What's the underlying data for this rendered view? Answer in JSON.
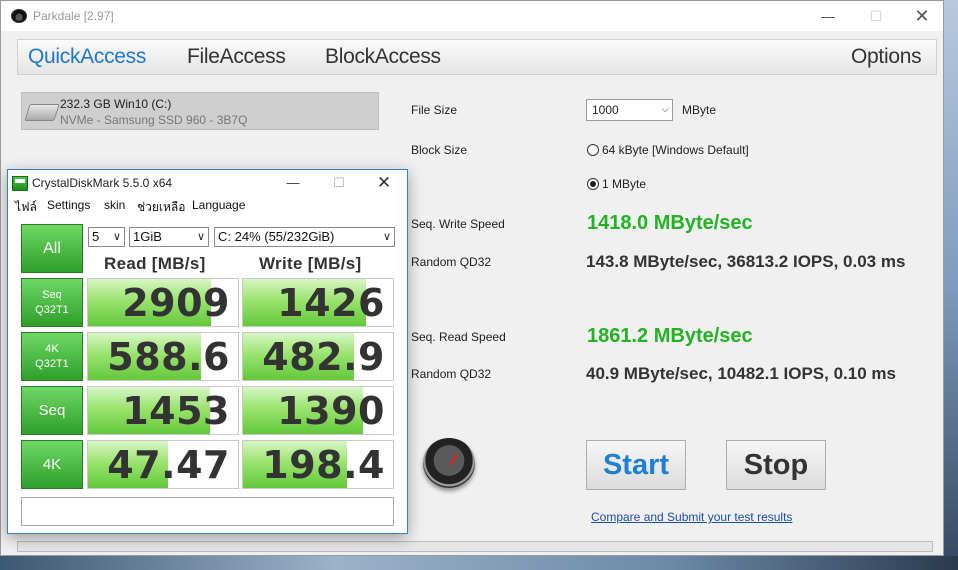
{
  "parkdale": {
    "title": "Parkdale [2.97]",
    "window_controls": {
      "minimize": "—",
      "maximize": "☐",
      "close": "✕"
    },
    "tabs": [
      "QuickAccess",
      "FileAccess",
      "BlockAccess",
      "Options"
    ],
    "active_tab": "QuickAccess",
    "drive": {
      "name": "232.3 GB Win10 (C:)",
      "model": "NVMe - Samsung SSD 960 - 3B7Q"
    },
    "file_size": {
      "label": "File Size",
      "value": "1000",
      "unit": "MByte"
    },
    "block_size": {
      "label": "Block Size",
      "options": [
        "64 kByte [Windows Default]",
        "1 MByte"
      ],
      "selected": "1 MByte"
    },
    "results": {
      "seq_write_label": "Seq. Write Speed",
      "seq_write_value": "1418.0 MByte/sec",
      "random_write_label": "Random QD32",
      "random_write_value": "143.8 MByte/sec, 36813.2 IOPS, 0.03 ms",
      "seq_read_label": "Seq. Read Speed",
      "seq_read_value": "1861.2 MByte/sec",
      "random_read_label": "Random QD32",
      "random_read_value": "40.9 MByte/sec, 10482.1 IOPS, 0.10 ms"
    },
    "start_label": "Start",
    "stop_label": "Stop",
    "link_text": "Compare and Submit your test results",
    "progress": 0,
    "colors": {
      "accent": "#1f78c8",
      "green": "#22b223"
    }
  },
  "cdm": {
    "title": "CrystalDiskMark 5.5.0 x64",
    "window_controls": {
      "minimize": "—",
      "maximize": "☐",
      "close": "✕"
    },
    "menu": [
      "ไฟล์",
      "Settings",
      "skin",
      "ช่วยเหลือ",
      "Language"
    ],
    "all_label": "All",
    "test_count": "5",
    "test_size": "1GiB",
    "drive": "C: 24% (55/232GiB)",
    "read_header": "Read [MB/s]",
    "write_header": "Write [MB/s]",
    "rows": [
      {
        "label_line1": "Seq",
        "label_line2": "Q32T1",
        "read": "2909",
        "write": "1426",
        "read_fill": 0.82,
        "write_fill": 0.82
      },
      {
        "label_line1": "4K",
        "label_line2": "Q32T1",
        "read": "588.6",
        "write": "482.9",
        "read_fill": 0.75,
        "write_fill": 0.74
      },
      {
        "label_line1": "Seq",
        "label_line2": "",
        "read": "1453",
        "write": "1390",
        "read_fill": 0.81,
        "write_fill": 0.8
      },
      {
        "label_line1": "4K",
        "label_line2": "",
        "read": "47.47",
        "write": "198.4",
        "read_fill": 0.53,
        "write_fill": 0.69
      }
    ],
    "comment": ""
  }
}
